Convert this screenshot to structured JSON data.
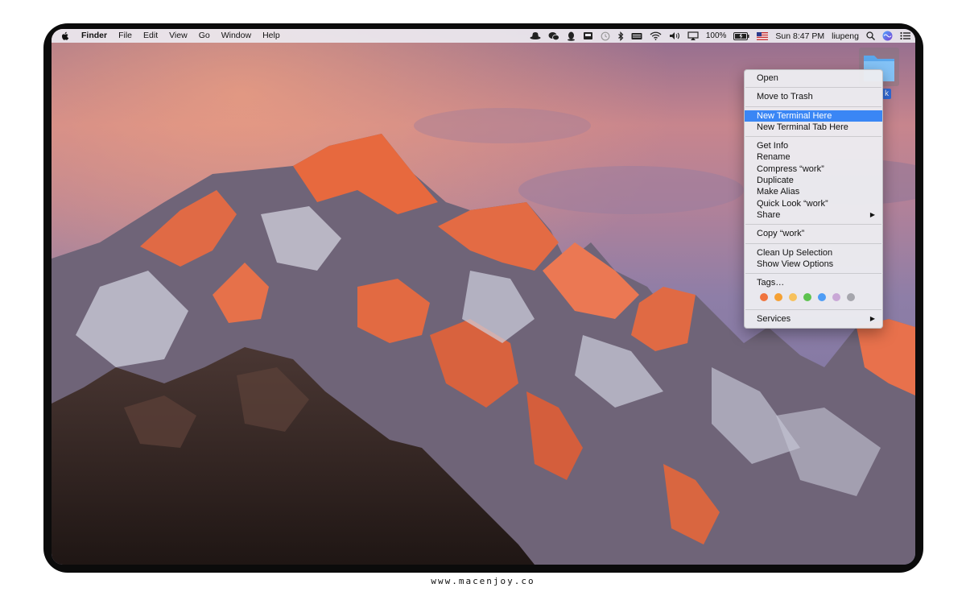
{
  "menubar": {
    "apple_icon": "apple-icon",
    "app_name": "Finder",
    "menus": [
      "File",
      "Edit",
      "View",
      "Go",
      "Window",
      "Help"
    ],
    "status_icons": [
      "hat-icon",
      "wechat-icon",
      "qq-icon",
      "inbox-icon",
      "time-machine-icon",
      "bluetooth-icon",
      "keyboard-icon",
      "wifi-icon",
      "volume-icon",
      "airplay-icon"
    ],
    "battery": "100%",
    "flag_icon": "us-flag-icon",
    "clock": "Sun 8:47 PM",
    "user": "liupeng",
    "right_icons": [
      "search-icon",
      "siri-icon",
      "notification-center-icon"
    ]
  },
  "desktop": {
    "folder_label_visible": "k",
    "folder_icon": "folder-icon"
  },
  "context_menu": {
    "groups": [
      {
        "items": [
          {
            "label": "Open"
          }
        ]
      },
      {
        "items": [
          {
            "label": "Move to Trash"
          }
        ]
      },
      {
        "items": [
          {
            "label": "New Terminal Here",
            "highlighted": true
          },
          {
            "label": "New Terminal Tab Here"
          }
        ]
      },
      {
        "items": [
          {
            "label": "Get Info"
          },
          {
            "label": "Rename"
          },
          {
            "label": "Compress “work”"
          },
          {
            "label": "Duplicate"
          },
          {
            "label": "Make Alias"
          },
          {
            "label": "Quick Look “work”"
          },
          {
            "label": "Share",
            "submenu": true
          }
        ]
      },
      {
        "items": [
          {
            "label": "Copy “work”"
          }
        ]
      },
      {
        "items": [
          {
            "label": "Clean Up Selection"
          },
          {
            "label": "Show View Options"
          }
        ]
      },
      {
        "items": [
          {
            "label": "Tags…"
          }
        ]
      },
      {
        "items": [
          {
            "label": "Services",
            "submenu": true
          }
        ]
      }
    ],
    "submenu_arrow": "▶",
    "tag_colors": [
      "#f0743e",
      "#f5a033",
      "#f7c15c",
      "#5dc24f",
      "#4e9cf5",
      "#c9a7d6",
      "#a6a6ad"
    ]
  },
  "colors": {
    "highlight": "#3a86f5",
    "bezel": "#0b0b0b"
  },
  "watermark": "www.macenjoy.co"
}
